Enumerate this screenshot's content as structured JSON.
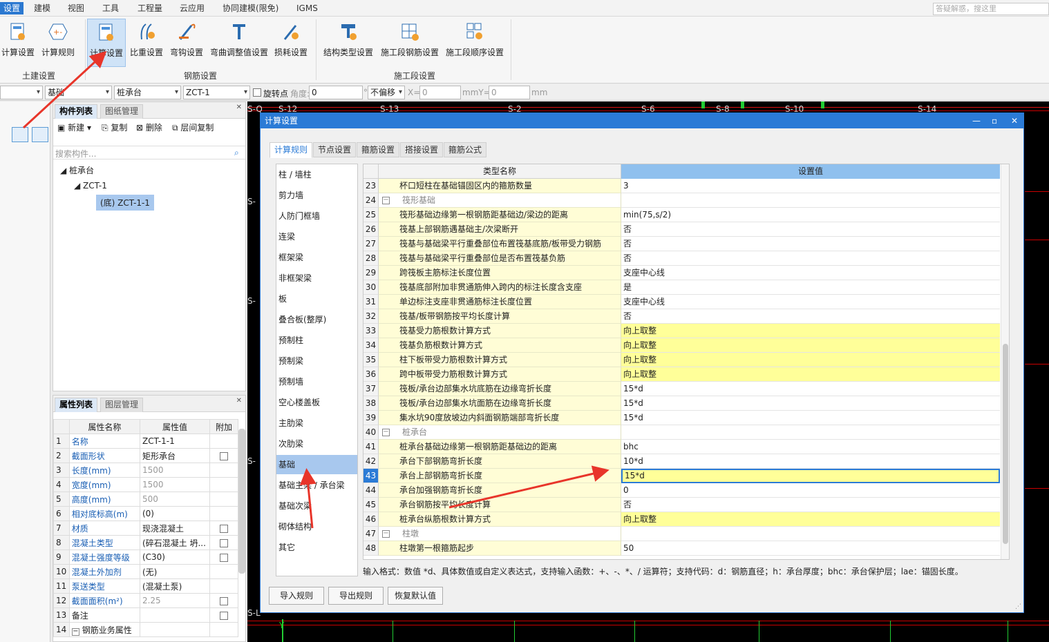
{
  "menu": {
    "items": [
      "设置",
      "建模",
      "视图",
      "工具",
      "工程量",
      "云应用",
      "协同建模(限免)",
      "IGMS"
    ],
    "search_placeholder": "答疑解惑，搜这里"
  },
  "ribbon": {
    "groups": [
      {
        "title": "土建设置",
        "buttons": [
          "计算设置",
          "计算规则"
        ]
      },
      {
        "title": "钢筋设置",
        "buttons": [
          "计算设置",
          "比重设置",
          "弯钩设置",
          "弯曲调整值设置",
          "损耗设置"
        ]
      },
      {
        "title": "施工段设置",
        "buttons": [
          "结构类型设置",
          "施工段钢筋设置",
          "施工段顺序设置"
        ]
      }
    ]
  },
  "toolbar2": {
    "combo1": "",
    "combo2": "基础",
    "combo3": "桩承台",
    "combo4": "ZCT-1",
    "rotate_label": "旋转点",
    "angle_label": "角度:",
    "angle_value": "0",
    "degree": "°",
    "offset": "不偏移",
    "x_label": "X=",
    "x_value": "0",
    "y_label": "mmY=",
    "y_value": "0",
    "mm": "mm"
  },
  "component_panel": {
    "tabs": [
      "构件列表",
      "图纸管理"
    ],
    "buttons": [
      "新建",
      "复制",
      "删除",
      "层间复制"
    ],
    "search_placeholder": "搜索构件...",
    "tree": [
      "桩承台",
      "ZCT-1",
      "(底) ZCT-1-1"
    ]
  },
  "property_panel": {
    "tabs": [
      "属性列表",
      "图层管理"
    ],
    "headers": [
      "属性名称",
      "属性值",
      "附加"
    ],
    "rows": [
      {
        "n": "1",
        "k": "名称",
        "v": "ZCT-1-1",
        "cb": false,
        "link": true,
        "gray": false
      },
      {
        "n": "2",
        "k": "截面形状",
        "v": "矩形承台",
        "cb": true,
        "link": true,
        "gray": false
      },
      {
        "n": "3",
        "k": "长度(mm)",
        "v": "1500",
        "cb": false,
        "link": true,
        "gray": true
      },
      {
        "n": "4",
        "k": "宽度(mm)",
        "v": "1500",
        "cb": false,
        "link": true,
        "gray": true
      },
      {
        "n": "5",
        "k": "高度(mm)",
        "v": "500",
        "cb": false,
        "link": true,
        "gray": true
      },
      {
        "n": "6",
        "k": "相对底标高(m)",
        "v": "(0)",
        "cb": false,
        "link": true,
        "gray": false
      },
      {
        "n": "7",
        "k": "材质",
        "v": "现浇混凝土",
        "cb": true,
        "link": true,
        "gray": false
      },
      {
        "n": "8",
        "k": "混凝土类型",
        "v": "(碎石混凝土 坍...",
        "cb": true,
        "link": true,
        "gray": false
      },
      {
        "n": "9",
        "k": "混凝土强度等级",
        "v": "(C30)",
        "cb": true,
        "link": true,
        "gray": false
      },
      {
        "n": "10",
        "k": "混凝土外加剂",
        "v": "(无)",
        "cb": false,
        "link": true,
        "gray": false
      },
      {
        "n": "11",
        "k": "泵送类型",
        "v": "(混凝土泵)",
        "cb": false,
        "link": true,
        "gray": false
      },
      {
        "n": "12",
        "k": "截面面积(m²)",
        "v": "2.25",
        "cb": true,
        "link": true,
        "gray": true
      },
      {
        "n": "13",
        "k": "备注",
        "v": "",
        "cb": true,
        "link": false,
        "gray": false
      },
      {
        "n": "14",
        "k": "钢筋业务属性",
        "v": "",
        "cb": false,
        "link": false,
        "gray": false
      }
    ]
  },
  "canvas": {
    "top_labels": [
      "S-Q",
      "S-12",
      "S-13",
      "S-2",
      "S-6",
      "S-8",
      "S-10",
      "S-14"
    ],
    "left_labels": [
      "S-",
      "S-",
      "S-",
      "S-L"
    ],
    "y_axis": "Y"
  },
  "dialog": {
    "title": "计算设置",
    "tabs": [
      "计算规则",
      "节点设置",
      "箍筋设置",
      "搭接设置",
      "箍筋公式"
    ],
    "categories": [
      "柱 / 墙柱",
      "剪力墙",
      "人防门框墙",
      "连梁",
      "框架梁",
      "非框架梁",
      "板",
      "叠合板(整厚)",
      "预制柱",
      "预制梁",
      "预制墙",
      "空心楼盖板",
      "主肋梁",
      "次肋梁",
      "基础",
      "基础主梁 / 承台梁",
      "基础次梁",
      "砌体结构",
      "其它"
    ],
    "selected_category": "基础",
    "grid_headers": [
      "类型名称",
      "设置值"
    ],
    "rows": [
      {
        "n": "23",
        "name": "杯口短柱在基础锚固区内的箍筋数量",
        "value": "3",
        "group": false,
        "hl": false
      },
      {
        "n": "24",
        "name": "筏形基础",
        "value": "",
        "group": true,
        "hl": false
      },
      {
        "n": "25",
        "name": "筏形基础边缘第一根钢筋距基础边/梁边的距离",
        "value": "min(75,s/2)",
        "group": false,
        "hl": false
      },
      {
        "n": "26",
        "name": "筏基上部钢筋遇基础主/次梁断开",
        "value": "否",
        "group": false,
        "hl": false
      },
      {
        "n": "27",
        "name": "筏基与基础梁平行重叠部位布置筏基底筋/板带受力钢筋",
        "value": "否",
        "group": false,
        "hl": false
      },
      {
        "n": "28",
        "name": "筏基与基础梁平行重叠部位是否布置筏基负筋",
        "value": "否",
        "group": false,
        "hl": false
      },
      {
        "n": "29",
        "name": "跨筏板主筋标注长度位置",
        "value": "支座中心线",
        "group": false,
        "hl": false
      },
      {
        "n": "30",
        "name": "筏基底部附加非贯通筋伸入跨内的标注长度含支座",
        "value": "是",
        "group": false,
        "hl": false
      },
      {
        "n": "31",
        "name": "单边标注支座非贯通筋标注长度位置",
        "value": "支座中心线",
        "group": false,
        "hl": false
      },
      {
        "n": "32",
        "name": "筏基/板带钢筋按平均长度计算",
        "value": "否",
        "group": false,
        "hl": false
      },
      {
        "n": "33",
        "name": "筏基受力筋根数计算方式",
        "value": "向上取整",
        "group": false,
        "hl": true
      },
      {
        "n": "34",
        "name": "筏基负筋根数计算方式",
        "value": "向上取整",
        "group": false,
        "hl": true
      },
      {
        "n": "35",
        "name": "柱下板带受力筋根数计算方式",
        "value": "向上取整",
        "group": false,
        "hl": true
      },
      {
        "n": "36",
        "name": "跨中板带受力筋根数计算方式",
        "value": "向上取整",
        "group": false,
        "hl": true
      },
      {
        "n": "37",
        "name": "筏板/承台边部集水坑底筋在边缘弯折长度",
        "value": "15*d",
        "group": false,
        "hl": false
      },
      {
        "n": "38",
        "name": "筏板/承台边部集水坑面筋在边缘弯折长度",
        "value": "15*d",
        "group": false,
        "hl": false
      },
      {
        "n": "39",
        "name": "集水坑90度放坡边内斜面钢筋端部弯折长度",
        "value": "15*d",
        "group": false,
        "hl": false
      },
      {
        "n": "40",
        "name": "桩承台",
        "value": "",
        "group": true,
        "hl": false
      },
      {
        "n": "41",
        "name": "桩承台基础边缘第一根钢筋距基础边的距离",
        "value": "bhc",
        "group": false,
        "hl": false
      },
      {
        "n": "42",
        "name": "承台下部钢筋弯折长度",
        "value": "10*d",
        "group": false,
        "hl": false
      },
      {
        "n": "43",
        "name": "承台上部钢筋弯折长度",
        "value": "15*d",
        "group": false,
        "hl": false,
        "current": true
      },
      {
        "n": "44",
        "name": "承台加强钢筋弯折长度",
        "value": "0",
        "group": false,
        "hl": false
      },
      {
        "n": "45",
        "name": "承台钢筋按平均长度计算",
        "value": "否",
        "group": false,
        "hl": false
      },
      {
        "n": "46",
        "name": "桩承台纵筋根数计算方式",
        "value": "向上取整",
        "group": false,
        "hl": true
      },
      {
        "n": "47",
        "name": "柱墩",
        "value": "",
        "group": true,
        "hl": false
      },
      {
        "n": "48",
        "name": "柱墩第一根箍筋起步",
        "value": "50",
        "group": false,
        "hl": false
      }
    ],
    "hint": "输入格式：数值 *d、具体数值或自定义表达式，支持输入函数：+、-、*、/ 运算符；支持代码：d：钢筋直径；h：承台厚度；bhc：承台保护层；lae：锚固长度。",
    "buttons": [
      "导入规则",
      "导出规则",
      "恢复默认值"
    ]
  }
}
